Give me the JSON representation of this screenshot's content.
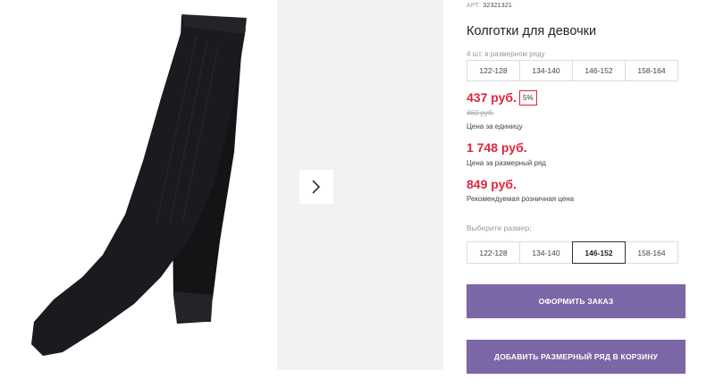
{
  "product": {
    "article_label": "АРТ.",
    "article_value": "32321321",
    "title": "Колготки для девочки",
    "image_icon": "black-tights-image"
  },
  "gallery": {
    "next_icon": "chevron-right-icon"
  },
  "pack": {
    "note": "4 шт. в размерном ряду",
    "sizes": [
      "122-128",
      "134-140",
      "146-152",
      "158-164"
    ]
  },
  "prices": {
    "unit_price": "437 руб.",
    "discount": "5%",
    "old_price": "460 руб.",
    "unit_label": "Цена за единицу",
    "row_price": "1 748 руб.",
    "row_label": "Цена за размерный ряд",
    "retail_price": "849 руб.",
    "retail_label": "Рекомендуемая розничная цена"
  },
  "size_select": {
    "label": "Выберите размер:",
    "options": [
      "122-128",
      "134-140",
      "146-152",
      "158-164"
    ],
    "selected": "146-152"
  },
  "actions": {
    "order_label": "ОФОРМИТЬ ЗАКАЗ",
    "add_row_label": "ДОБАВИТЬ РАЗМЕРНЫЙ РЯД В КОРЗИНУ"
  },
  "colors": {
    "accent": "#7b66a6",
    "price": "#e0253b"
  }
}
